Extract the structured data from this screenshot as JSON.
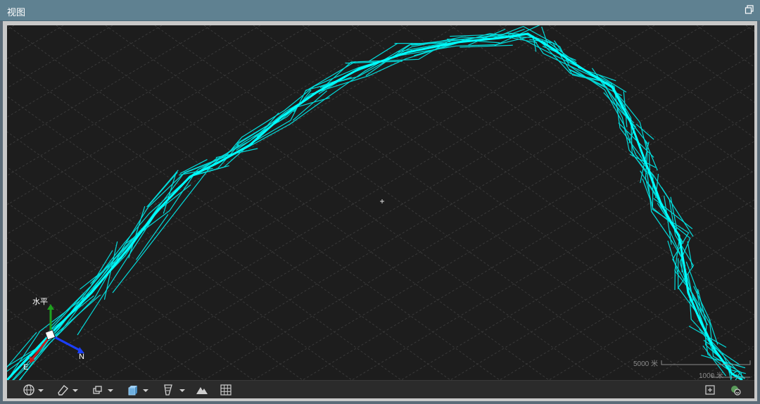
{
  "window": {
    "title": "视图"
  },
  "compass": {
    "vertical_label": "水平",
    "east_label": "E",
    "north_label": "N"
  },
  "scale_bar": {
    "primary": "5000 米",
    "secondary": "1000 米"
  },
  "colors": {
    "track": "#00f0f0",
    "background": "#1d1d1d",
    "grid": "#3a3a3a",
    "titlebar": "#5f8191"
  },
  "toolbar": {
    "left_tools": [
      {
        "icon": "globe-icon",
        "has_dropdown": true
      },
      {
        "icon": "eraser-icon",
        "has_dropdown": true
      },
      {
        "icon": "layers-icon",
        "has_dropdown": true
      },
      {
        "icon": "cube-icon",
        "has_dropdown": true
      },
      {
        "icon": "profile-icon",
        "has_dropdown": true
      },
      {
        "icon": "terrain-icon",
        "has_dropdown": false
      },
      {
        "icon": "grid-icon",
        "has_dropdown": false
      }
    ],
    "right_tools": [
      {
        "icon": "add-view-icon"
      },
      {
        "icon": "settings-sync-icon"
      }
    ]
  }
}
